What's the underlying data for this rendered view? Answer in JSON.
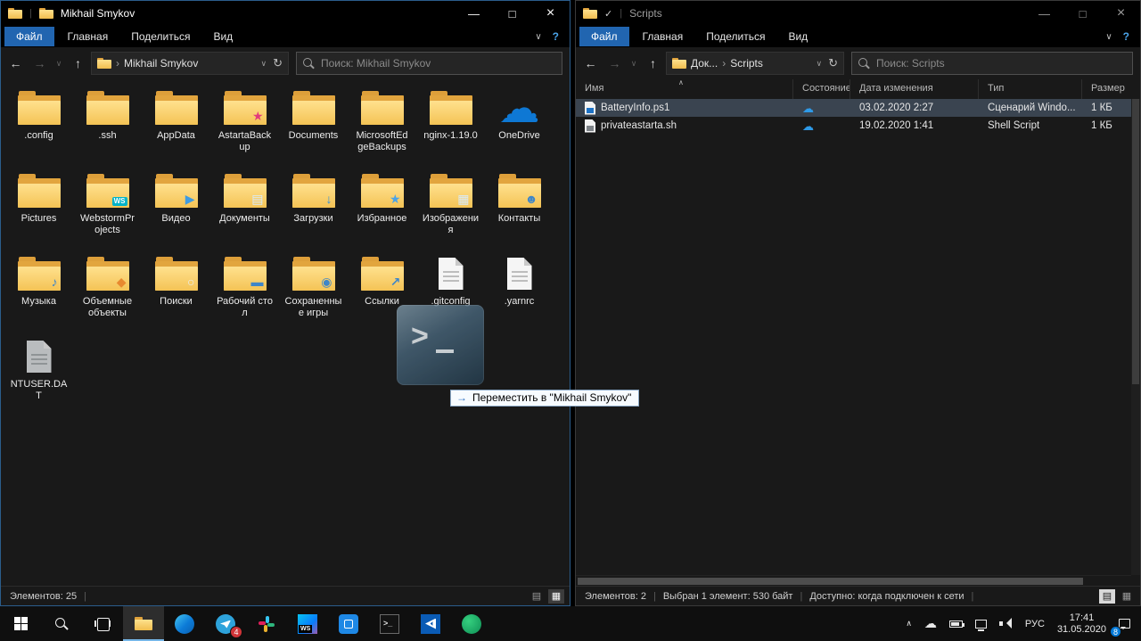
{
  "left_window": {
    "title": "Mikhail Smykov",
    "menu": {
      "file": "Файл",
      "home": "Главная",
      "share": "Поделиться",
      "view": "Вид"
    },
    "nav": {
      "crumb": "Mikhail Smykov",
      "search_placeholder": "Поиск: Mikhail Smykov"
    },
    "items": [
      {
        "label": ".config",
        "icon": "folder"
      },
      {
        "label": ".ssh",
        "icon": "folder"
      },
      {
        "label": "AppData",
        "icon": "folder"
      },
      {
        "label": "AstartaBackup",
        "icon": "folder-star"
      },
      {
        "label": "Documents",
        "icon": "folder"
      },
      {
        "label": "MicrosoftEdgeBackups",
        "icon": "folder"
      },
      {
        "label": "nginx-1.19.0",
        "icon": "folder"
      },
      {
        "label": "OneDrive",
        "icon": "onedrive"
      },
      {
        "label": "Pictures",
        "icon": "folder"
      },
      {
        "label": "WebstormProjects",
        "icon": "folder-webstorm"
      },
      {
        "label": "Видео",
        "icon": "folder-video"
      },
      {
        "label": "Документы",
        "icon": "folder-documents"
      },
      {
        "label": "Загрузки",
        "icon": "folder-downloads"
      },
      {
        "label": "Избранное",
        "icon": "folder-favorites"
      },
      {
        "label": "Изображения",
        "icon": "folder-images"
      },
      {
        "label": "Контакты",
        "icon": "folder-contacts"
      },
      {
        "label": "Музыка",
        "icon": "folder-music"
      },
      {
        "label": "Объемные объекты",
        "icon": "folder-3d"
      },
      {
        "label": "Поиски",
        "icon": "folder-search"
      },
      {
        "label": "Рабочий стол",
        "icon": "folder-desktop"
      },
      {
        "label": "Сохраненные игры",
        "icon": "folder-games"
      },
      {
        "label": "Ссылки",
        "icon": "folder-links"
      },
      {
        "label": ".gitconfig",
        "icon": "file"
      },
      {
        "label": ".yarnrc",
        "icon": "file"
      },
      {
        "label": "NTUSER.DAT",
        "icon": "file-gray"
      }
    ],
    "status": {
      "items_count": "Элементов: 25"
    },
    "drag": {
      "arrow": "→",
      "tooltip": "Переместить в \"Mikhail Smykov\""
    }
  },
  "right_window": {
    "title": "Scripts",
    "menu": {
      "file": "Файл",
      "home": "Главная",
      "share": "Поделиться",
      "view": "Вид"
    },
    "nav": {
      "crumb1": "Док...",
      "crumb2": "Scripts",
      "search_placeholder": "Поиск: Scripts"
    },
    "columns": {
      "name": "Имя",
      "status": "Состояние",
      "date": "Дата изменения",
      "type": "Тип",
      "size": "Размер"
    },
    "rows": [
      {
        "name": "BatteryInfo.ps1",
        "icon": "ps1",
        "status_icon": "cloud",
        "date": "03.02.2020 2:27",
        "type": "Сценарий Windo...",
        "size": "1 КБ",
        "selected": true
      },
      {
        "name": "privateastarta.sh",
        "icon": "sh",
        "status_icon": "cloud",
        "date": "19.02.2020 1:41",
        "type": "Shell Script",
        "size": "1 КБ",
        "selected": false
      }
    ],
    "status": {
      "items_count": "Элементов: 2",
      "selection": "Выбран 1 элемент: 530 байт",
      "availability": "Доступно: когда подключен к сети"
    }
  },
  "taskbar": {
    "badges": {
      "telegram": "4",
      "notifications": "8"
    },
    "tray": {
      "language": "РУС",
      "time": "17:41",
      "date": "31.05.2020"
    }
  }
}
